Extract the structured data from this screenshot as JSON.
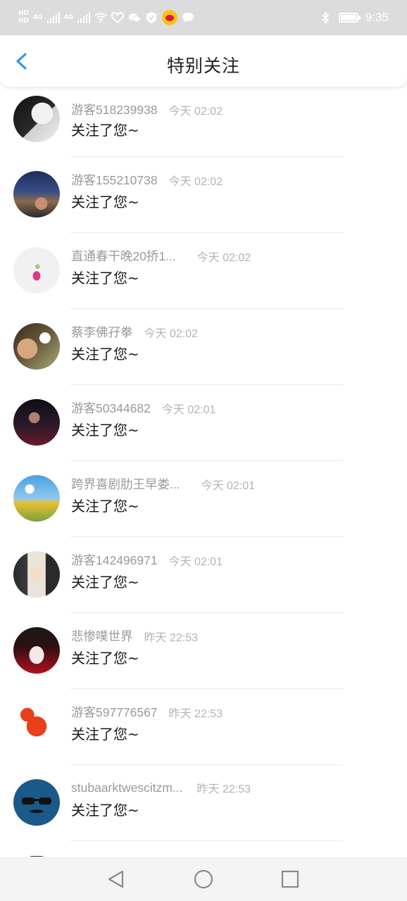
{
  "status_bar": {
    "hd_top": "HD",
    "hd_bottom": "HD",
    "network_1": "4G",
    "network_2": "4G",
    "time": "9:35",
    "icons": [
      "wifi-icon",
      "heart-icon",
      "wechat-icon",
      "shield-icon",
      "weibo-icon",
      "chat-bubble-icon",
      "bluetooth-icon",
      "battery-icon"
    ]
  },
  "header": {
    "title": "特别关注",
    "back_icon": "chevron-left-icon",
    "accent_color": "#2196f3"
  },
  "items": [
    {
      "name": "游客518239938",
      "time": "今天 02:02",
      "message": "关注了您~"
    },
    {
      "name": "游客155210738",
      "time": "今天 02:02",
      "message": "关注了您~"
    },
    {
      "name": "直通春干晚20挢1...",
      "time": "今天 02:02",
      "message": "关注了您~"
    },
    {
      "name": "蔡李佛孖拳",
      "time": "今天 02:02",
      "message": "关注了您~"
    },
    {
      "name": "游客50344682",
      "time": "今天 02:01",
      "message": "关注了您~"
    },
    {
      "name": "跨界喜剧肋王早娄...",
      "time": "今天 02:01",
      "message": "关注了您~"
    },
    {
      "name": "游客142496971",
      "time": "今天 02:01",
      "message": "关注了您~"
    },
    {
      "name": "悲惨噗世界",
      "time": "昨天 22:53",
      "message": "关注了您~"
    },
    {
      "name": "游客597776567",
      "time": "昨天 22:53",
      "message": "关注了您~"
    },
    {
      "name": "stubaarktwescitzm...",
      "time": "昨天 22:53",
      "message": "关注了您~"
    }
  ],
  "nav_bar": {
    "icons": [
      "back-triangle-icon",
      "home-circle-icon",
      "recents-square-icon"
    ]
  }
}
